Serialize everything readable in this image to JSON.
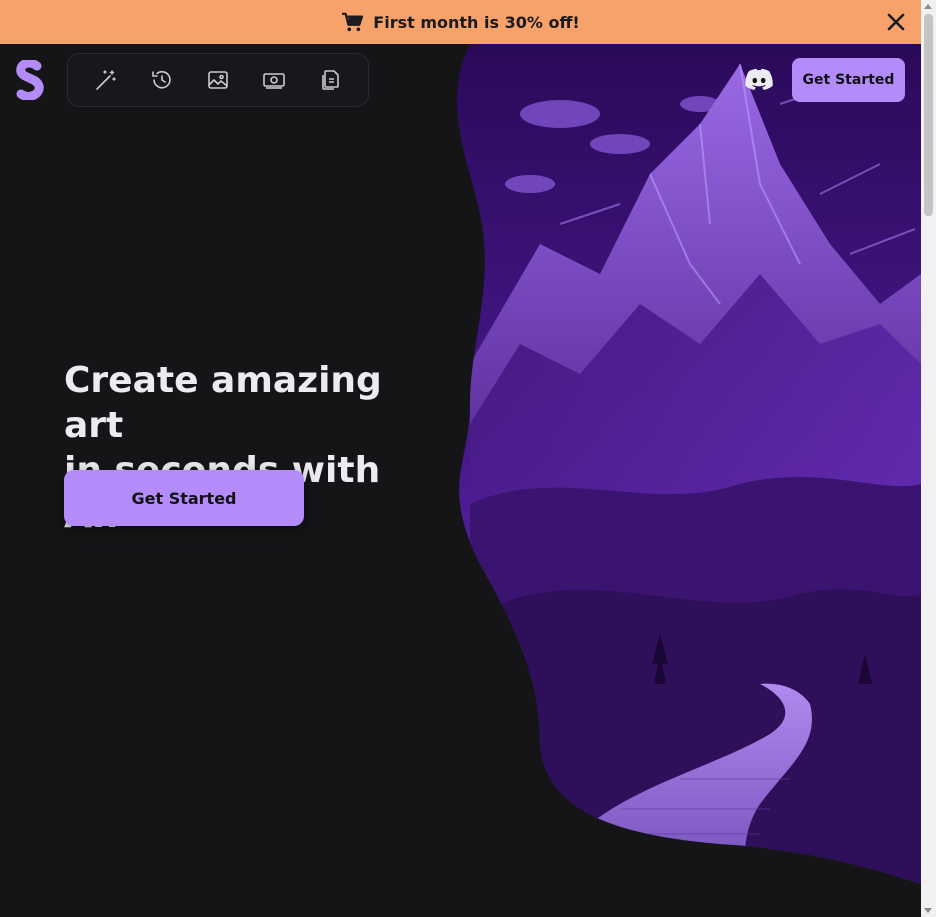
{
  "banner": {
    "text": "First month is 30% off!",
    "icon": "cart-icon",
    "close_icon": "close-icon",
    "color": "#f7a26a"
  },
  "brand": {
    "logo": "stable-diffusion-logo",
    "color": "#b38cf9"
  },
  "toolbar": {
    "items": [
      {
        "name": "magic-wand-icon"
      },
      {
        "name": "history-icon"
      },
      {
        "name": "image-icon"
      },
      {
        "name": "money-icon"
      },
      {
        "name": "documents-icon"
      }
    ]
  },
  "header": {
    "discord_icon": "discord-icon",
    "cta_label": "Get Started",
    "accent": "#b38cf9"
  },
  "hero": {
    "headline_line1": "Create amazing art",
    "headline_line2": "in seconds with AI.",
    "cta_label": "Get Started",
    "image": "purple-mountain-path-illustration"
  },
  "theme": {
    "background": "#151518",
    "text": "#ececf0"
  }
}
